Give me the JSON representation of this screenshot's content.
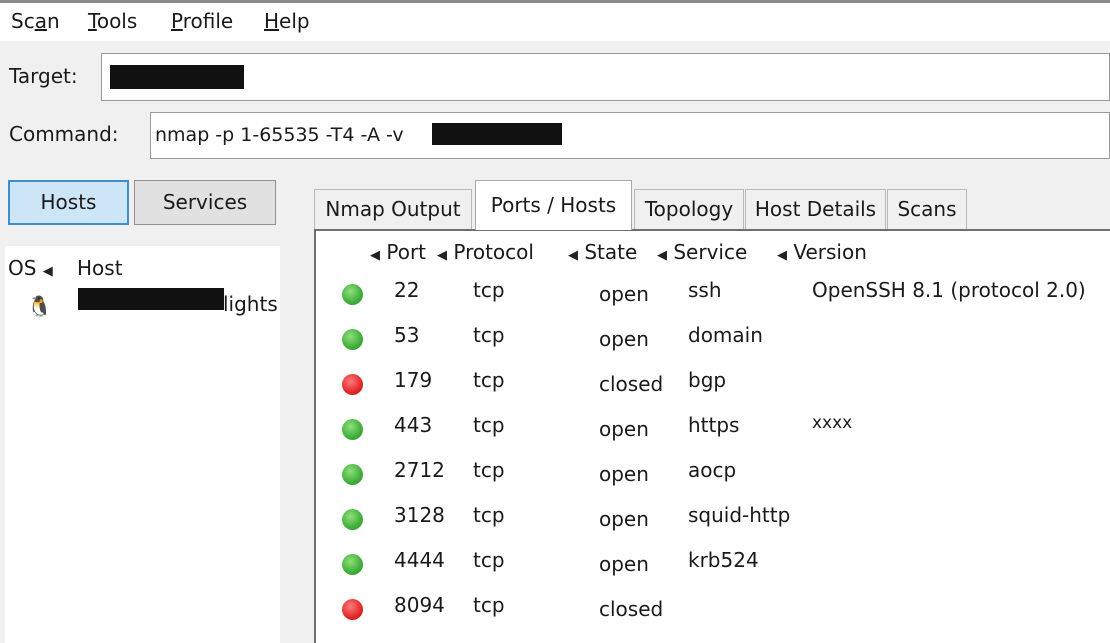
{
  "menu": {
    "scan": "Scan",
    "tools": "Tools",
    "profile": "Profile",
    "help": "Help"
  },
  "target": {
    "label": "Target:",
    "value": ""
  },
  "command": {
    "label": "Command:",
    "value": "nmap -p 1-65535 -T4 -A -v"
  },
  "left": {
    "hosts_button": "Hosts",
    "services_button": "Services",
    "col_os": "OS",
    "col_host": "Host",
    "host_suffix": "lights",
    "host_icon": "linux-penguin-icon"
  },
  "tabs": {
    "nmap_output": "Nmap Output",
    "ports_hosts": "Ports / Hosts",
    "topology": "Topology",
    "host_details": "Host Details",
    "scans": "Scans"
  },
  "ports": {
    "columns": [
      "Port",
      "Protocol",
      "State",
      "Service",
      "Version"
    ],
    "rows": [
      {
        "port": "22",
        "protocol": "tcp",
        "state": "open",
        "service": "ssh",
        "version": "OpenSSH 8.1 (protocol 2.0)"
      },
      {
        "port": "53",
        "protocol": "tcp",
        "state": "open",
        "service": "domain",
        "version": ""
      },
      {
        "port": "179",
        "protocol": "tcp",
        "state": "closed",
        "service": "bgp",
        "version": ""
      },
      {
        "port": "443",
        "protocol": "tcp",
        "state": "open",
        "service": "https",
        "version": "xxxx"
      },
      {
        "port": "2712",
        "protocol": "tcp",
        "state": "open",
        "service": "aocp",
        "version": ""
      },
      {
        "port": "3128",
        "protocol": "tcp",
        "state": "open",
        "service": "squid-http",
        "version": ""
      },
      {
        "port": "4444",
        "protocol": "tcp",
        "state": "open",
        "service": "krb524",
        "version": ""
      },
      {
        "port": "8094",
        "protocol": "tcp",
        "state": "closed",
        "service": "",
        "version": ""
      }
    ]
  },
  "colors": {
    "open": "#3fae3a",
    "closed": "#e02828",
    "active_button": "#cde6f7",
    "redaction": "#111111"
  }
}
